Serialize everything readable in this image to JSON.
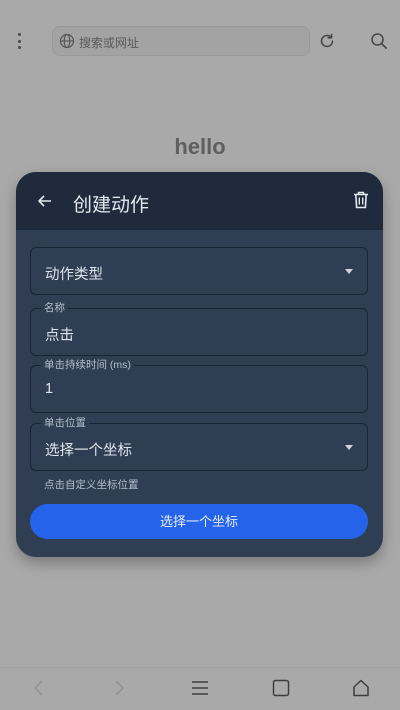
{
  "browser": {
    "url_placeholder": "搜索或网址",
    "icons": [
      "more-vert-icon",
      "globe-icon",
      "reload-icon",
      "search-icon"
    ]
  },
  "page": {
    "heading": "hello"
  },
  "dialog": {
    "title": "创建动作",
    "action_type_value": "动作类型",
    "name_label": "名称",
    "name_value": "点击",
    "duration_label": "单击持续时间 (ms)",
    "duration_value": "1",
    "position_label": "单击位置",
    "position_value": "选择一个坐标",
    "helper_text": "点击自定义坐标位置",
    "primary_button": "选择一个坐标",
    "colors": {
      "header": "#1f2b3c",
      "body": "#2f3e53",
      "accent": "#2563eb"
    }
  },
  "bottom_nav": {
    "icons": [
      "back-icon",
      "forward-icon",
      "menu-icon",
      "tabs-icon",
      "home-icon"
    ]
  }
}
